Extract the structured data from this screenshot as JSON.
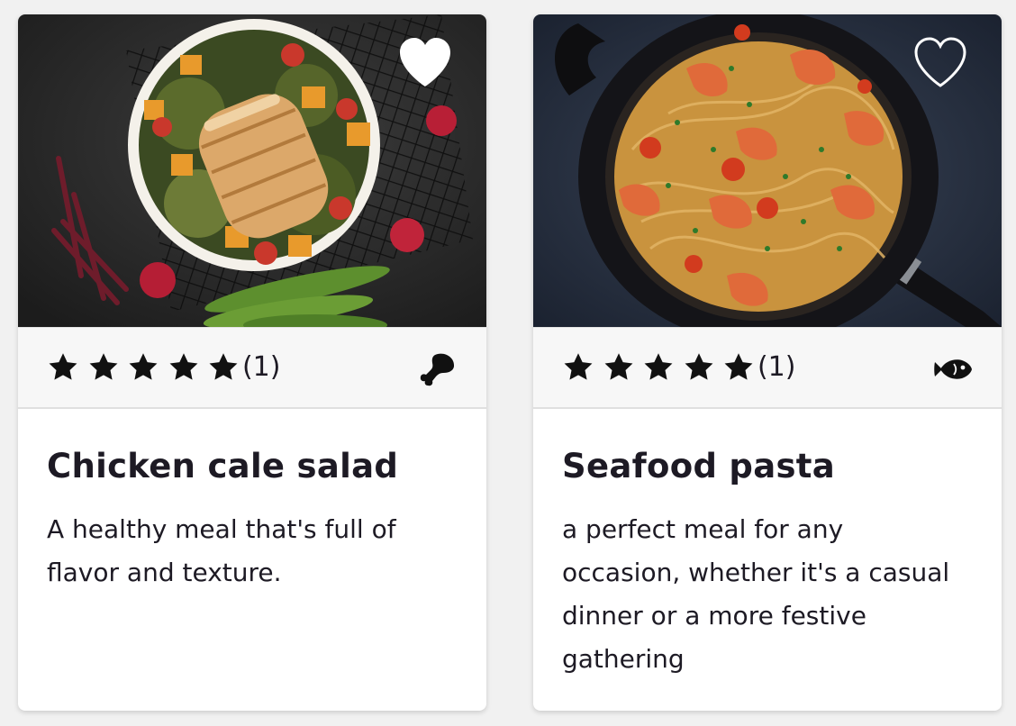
{
  "cards": [
    {
      "title": "Chicken cale salad",
      "description": "A healthy meal that's full of flavor and texture.",
      "rating": 5,
      "rating_count": "(1)",
      "category_icon": "chicken-drumstick-icon",
      "favorited": true,
      "image": "chicken-salad-bowl-photo"
    },
    {
      "title": "Seafood pasta",
      "description": "a perfect meal for any occasion, whether it's a casual dinner or a more festive gathering",
      "rating": 5,
      "rating_count": "(1)",
      "category_icon": "fish-icon",
      "favorited": false,
      "image": "shrimp-pasta-pan-photo"
    }
  ],
  "colors": {
    "text": "#1d1a24",
    "card_background": "#ffffff",
    "rating_bar_background": "#f7f7f7",
    "page_background": "#f1f1f1",
    "favorite_heart": "#ffffff"
  }
}
